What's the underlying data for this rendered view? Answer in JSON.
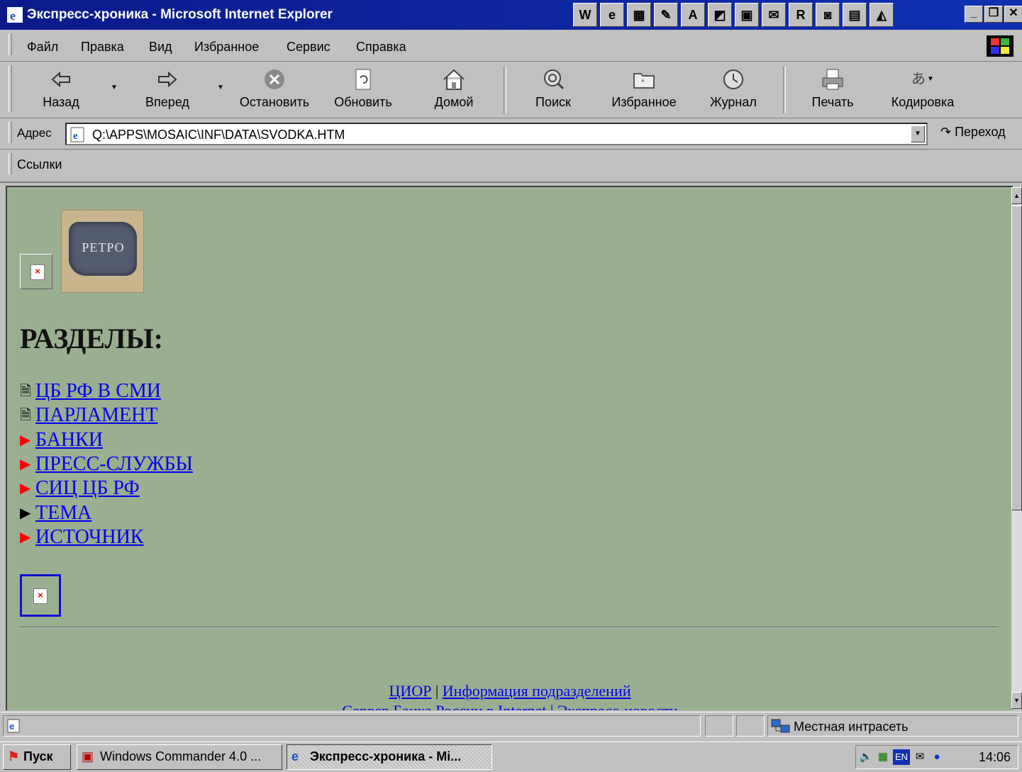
{
  "window": {
    "title": "Экспресс-хроника - Microsoft Internet Explorer",
    "tool_icons": [
      "W",
      "e",
      "▦",
      "✎",
      "A",
      "◩",
      "▣",
      "✉",
      "R",
      "◙",
      "▤",
      "◭"
    ]
  },
  "menu": {
    "items": [
      "Файл",
      "Правка",
      "Вид",
      "Избранное",
      "Сервис",
      "Справка"
    ]
  },
  "toolbar": {
    "back": "Назад",
    "forward": "Вперед",
    "stop": "Остановить",
    "refresh": "Обновить",
    "home": "Домой",
    "search": "Поиск",
    "favorites": "Избранное",
    "history": "Журнал",
    "print": "Печать",
    "encoding": "Кодировка"
  },
  "address": {
    "label": "Адрес",
    "value": "Q:\\APPS\\MOSAIC\\INF\\DATA\\SVODKA.HTM",
    "go": "Переход"
  },
  "links": {
    "label": "Ссылки"
  },
  "content": {
    "logo_text": "РЕТРО",
    "heading": "РАЗДЕЛЫ:",
    "sections": [
      {
        "label": "ЦБ РФ В СМИ",
        "marker": "doc",
        "marker_color": "#000000"
      },
      {
        "label": "ПАРЛАМЕНТ",
        "marker": "doc",
        "marker_color": "#000000"
      },
      {
        "label": "БАНКИ",
        "marker": "arrow",
        "marker_color": "#ff0000"
      },
      {
        "label": "ПРЕСС-СЛУЖБЫ",
        "marker": "arrow",
        "marker_color": "#ff0000"
      },
      {
        "label": "СИЦ ЦБ РФ",
        "marker": "arrow",
        "marker_color": "#ff0000"
      },
      {
        "label": "ТЕМА",
        "marker": "arrow",
        "marker_color": "#000000"
      },
      {
        "label": "ИСТОЧНИК",
        "marker": "arrow",
        "marker_color": "#ff0000"
      }
    ],
    "footer": {
      "link1": "ЦИОР",
      "separator": "|",
      "link2": "Информация подразделений",
      "line2": "Сервер Банка России в Internet | Экспресс-новости"
    }
  },
  "status": {
    "zone": "Местная интрасеть"
  },
  "taskbar": {
    "start": "Пуск",
    "tasks": [
      "Windows Commander 4.0 ...",
      "Экспресс-хроника - Mi..."
    ],
    "lang": "EN",
    "clock": "14:06"
  }
}
